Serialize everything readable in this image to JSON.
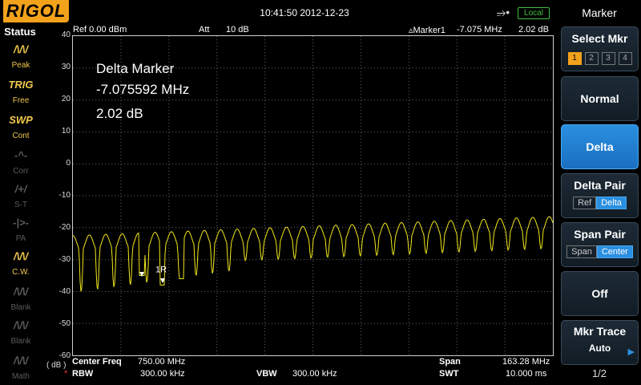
{
  "topbar": {
    "brand": "RIGOL",
    "datetime": "10:41:50 2012-12-23",
    "local_label": "Local",
    "usb_icon": "usb-icon"
  },
  "status": {
    "title": "Status",
    "items": [
      {
        "icon_text": "/\\/\\/",
        "label": "Peak",
        "active": true
      },
      {
        "icon_text": "TRIG",
        "label": "Free",
        "active": true
      },
      {
        "icon_text": "SWP",
        "label": "Cont",
        "active": true
      },
      {
        "icon_text": "-^-",
        "label": "Corr",
        "active": false
      },
      {
        "icon_text": "/+/",
        "label": "S-T",
        "active": false
      },
      {
        "icon_text": "-|>-",
        "label": "PA",
        "active": false
      },
      {
        "icon_text": "/\\/\\/",
        "label": "C.W.",
        "active": true
      },
      {
        "icon_text": "/\\/\\/",
        "label": "Blank",
        "active": false
      },
      {
        "icon_text": "/\\/\\/",
        "label": "Blank",
        "active": false
      },
      {
        "icon_text": "/\\/\\/",
        "label": "Math",
        "active": false
      }
    ]
  },
  "header": {
    "ref": "Ref  0.00 dBm",
    "att_label": "Att",
    "att_value": "10 dB",
    "marker_label": "▵Marker1",
    "marker_freq": "-7.075 MHz",
    "marker_level": "2.02 dB"
  },
  "delta": {
    "title": "Delta Marker",
    "freq": "-7.075592 MHz",
    "level": "2.02 dB"
  },
  "marker_tag": "1R",
  "y_axis": {
    "unit": "( dB )",
    "ticks": [
      "40",
      "30",
      "20",
      "10",
      "0",
      "-10",
      "-20",
      "-30",
      "-40",
      "-50",
      "-60"
    ]
  },
  "bottom": {
    "center_label": "Center Freq",
    "center_value": "750.00 MHz",
    "span_label": "Span",
    "span_value": "163.28 MHz",
    "rbw_label": "RBW",
    "rbw_value": "300.00 kHz",
    "vbw_label": "VBW",
    "vbw_value": "300.00 kHz",
    "swt_label": "SWT",
    "swt_value": "10.000 ms",
    "rbw_star": "*"
  },
  "menu": {
    "title": "Marker",
    "select_label": "Select Mkr",
    "markers": [
      "1",
      "2",
      "3",
      "4"
    ],
    "normal": "Normal",
    "delta": "Delta",
    "delta_pair": "Delta Pair",
    "delta_pair_opts": [
      "Ref",
      "Delta"
    ],
    "span_pair": "Span Pair",
    "span_pair_opts": [
      "Span",
      "Center"
    ],
    "off": "Off",
    "mkr_trace": "Mkr Trace",
    "mkr_trace_value": "Auto",
    "page": "1/2"
  },
  "colors": {
    "trace": "#f2e81a",
    "brand": "#f3a21b",
    "accent": "#2a8fe0",
    "local": "#3fbf3f"
  }
}
